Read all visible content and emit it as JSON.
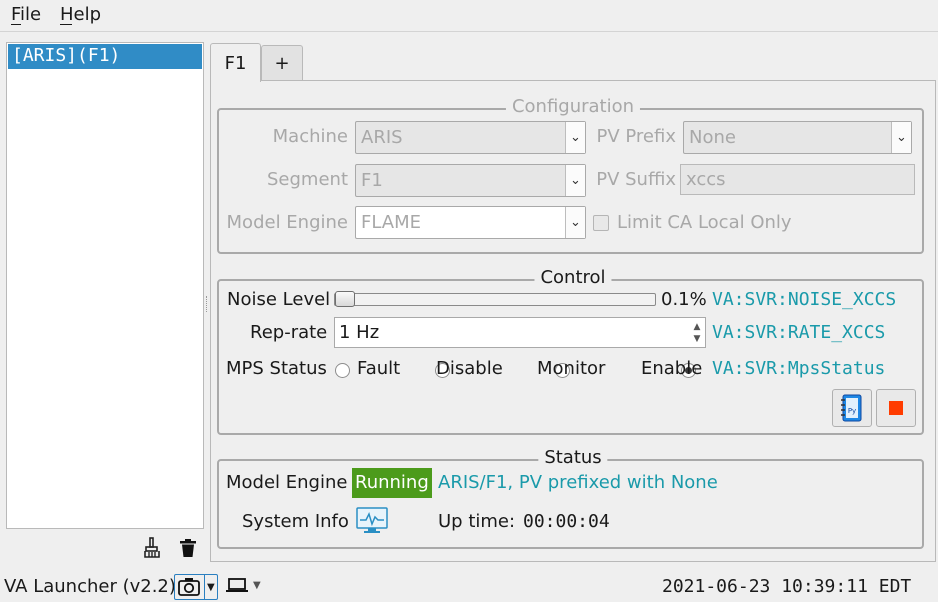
{
  "menu": {
    "file": "File",
    "help": "Help"
  },
  "machine_list": {
    "selected": "[ARIS](F1)"
  },
  "tabs": {
    "active": "F1",
    "add": "+"
  },
  "configuration": {
    "title": "Configuration",
    "machine_label": "Machine",
    "machine_value": "ARIS",
    "pv_prefix_label": "PV Prefix",
    "pv_prefix_value": "None",
    "segment_label": "Segment",
    "segment_value": "F1",
    "pv_suffix_label": "PV Suffix",
    "pv_suffix_value": "xccs",
    "model_engine_label": "Model Engine",
    "model_engine_value": "FLAME",
    "limit_ca_label": "Limit CA Local Only",
    "limit_ca_checked": false
  },
  "control": {
    "title": "Control",
    "noise_label": "Noise Level",
    "noise_value_text": "0.1%",
    "noise_fraction": 0.001,
    "noise_pv": "VA:SVR:NOISE_XCCS",
    "rep_rate_label": "Rep-rate",
    "rep_rate_value": "1 Hz",
    "rep_rate_pv": "VA:SVR:RATE_XCCS",
    "mps_label": "MPS Status",
    "mps_options": [
      "Fault",
      "Disable",
      "Monitor",
      "Enable"
    ],
    "mps_selected": "Enable",
    "mps_pv": "VA:SVR:MpsStatus"
  },
  "status": {
    "title": "Status",
    "model_engine_label": "Model Engine",
    "state": "Running",
    "state_color": "#4c9b1b",
    "description": "ARIS/F1, PV prefixed with None",
    "system_info_label": "System Info",
    "uptime_label": "Up time:",
    "uptime_value": "00:00:04"
  },
  "statusbar": {
    "app_name": "VA Launcher (v2.2)",
    "datetime": "2021-06-23 10:39:11 EDT"
  },
  "colors": {
    "accent": "#308cc6",
    "pv_text": "#1a9aaa",
    "stop": "#ff3c00"
  }
}
